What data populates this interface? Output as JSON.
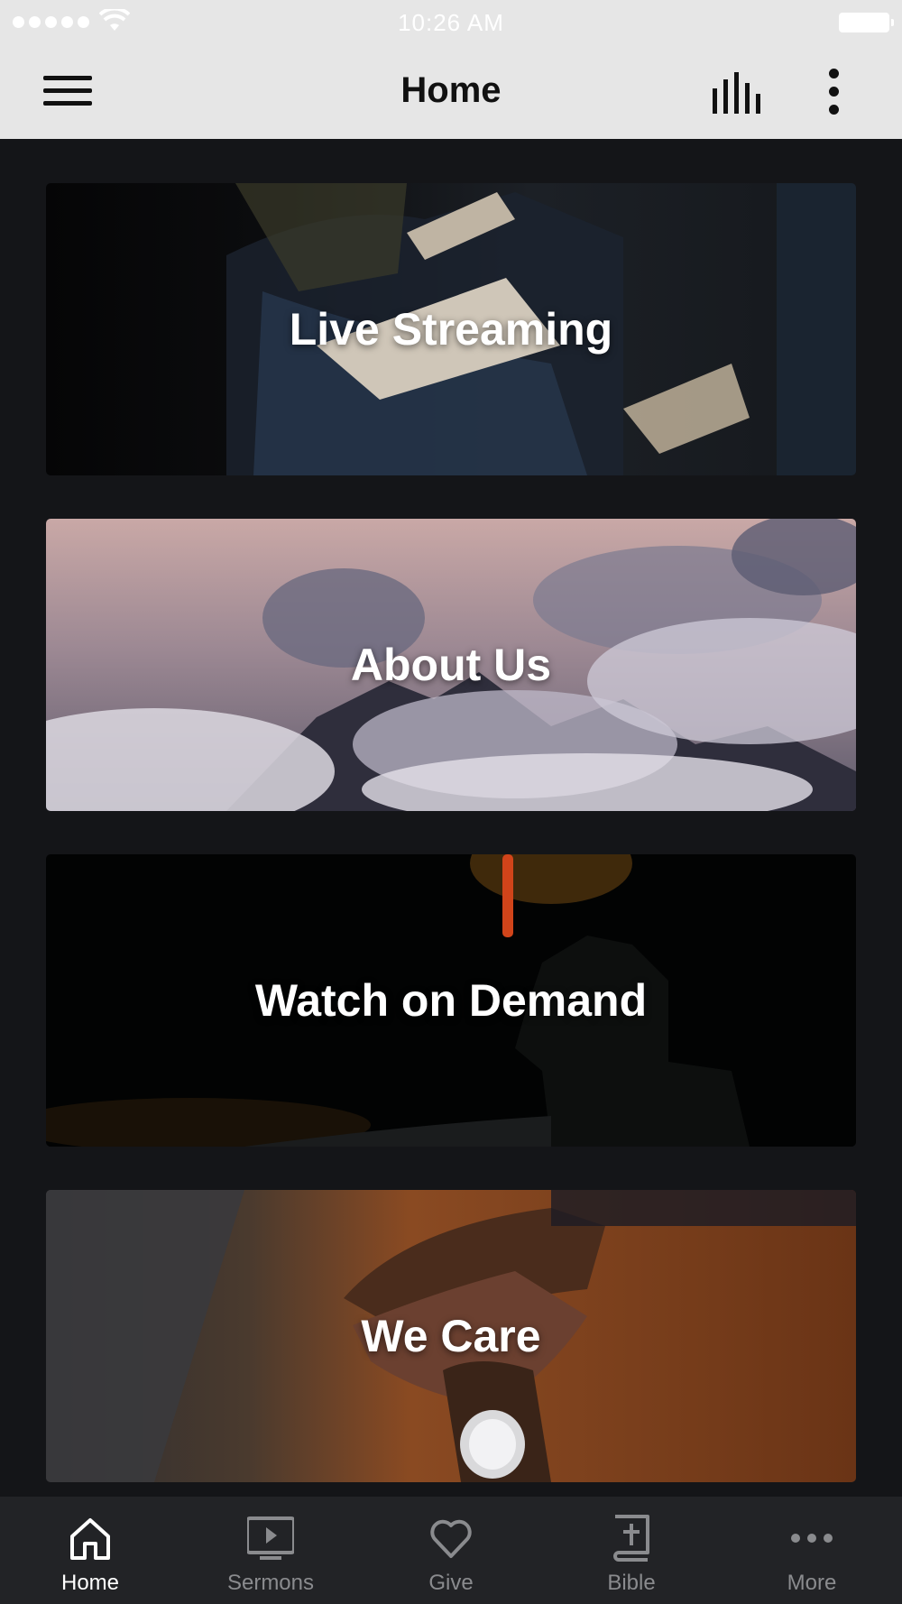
{
  "status_bar": {
    "time": "10:26 AM"
  },
  "nav_bar": {
    "title": "Home",
    "left_icon": "hamburger-menu-icon",
    "right_icons": [
      "audio-bars-icon",
      "vertical-ellipsis-icon"
    ]
  },
  "tiles": [
    {
      "label": "Live Streaming",
      "image": "people-reading-bibles-photo"
    },
    {
      "label": "About Us",
      "image": "mountains-in-clouds-photo"
    },
    {
      "label": "Watch on Demand",
      "image": "man-silhouette-dark-photo"
    },
    {
      "label": "We Care",
      "image": "clasped-hands-on-wood-table-photo"
    }
  ],
  "tab_bar": {
    "items": [
      {
        "label": "Home",
        "icon": "home-icon",
        "active": true
      },
      {
        "label": "Sermons",
        "icon": "tv-play-icon",
        "active": false
      },
      {
        "label": "Give",
        "icon": "heart-icon",
        "active": false
      },
      {
        "label": "Bible",
        "icon": "bible-cross-icon",
        "active": false
      },
      {
        "label": "More",
        "icon": "horizontal-ellipsis-icon",
        "active": false
      }
    ]
  },
  "colors": {
    "header_background": "#e6e6e6",
    "content_background": "#141518",
    "tab_bar_background": "#222326",
    "tab_active": "#ffffff",
    "tab_inactive": "#8a8b8e"
  }
}
